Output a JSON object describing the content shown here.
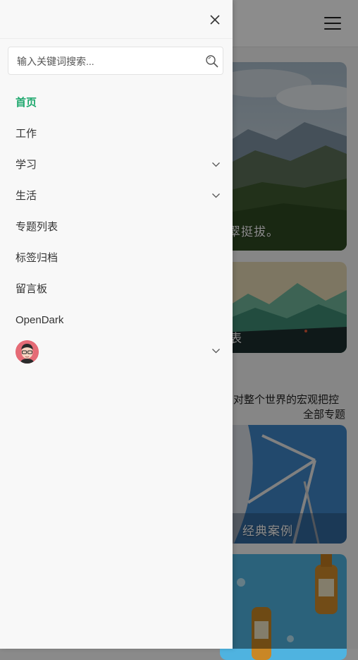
{
  "background": {
    "card1_caption": "翠挺拔。",
    "card2_caption": "表",
    "section_desc": "的对整个世界的宏观把控",
    "all_topics_link": "全部专题",
    "card3_caption": "经典案例"
  },
  "drawer": {
    "search": {
      "placeholder": "输入关键词搜索...",
      "value": ""
    },
    "nav": [
      {
        "label": "首页",
        "active": true,
        "has_submenu": false
      },
      {
        "label": "工作",
        "active": false,
        "has_submenu": false
      },
      {
        "label": "学习",
        "active": false,
        "has_submenu": true
      },
      {
        "label": "生活",
        "active": false,
        "has_submenu": true
      },
      {
        "label": "专题列表",
        "active": false,
        "has_submenu": false
      },
      {
        "label": "标签归档",
        "active": false,
        "has_submenu": false
      },
      {
        "label": "留言板",
        "active": false,
        "has_submenu": false
      },
      {
        "label": "OpenDark",
        "active": false,
        "has_submenu": false
      }
    ],
    "user_menu": {
      "has_submenu": true
    }
  },
  "colors": {
    "accent": "#1fa86e",
    "drawer_bg": "#f8f8f8",
    "overlay": "rgba(0,0,0,0.45)"
  },
  "icons": [
    "close-icon",
    "search-icon",
    "chevron-down-icon",
    "hamburger-menu-icon"
  ]
}
